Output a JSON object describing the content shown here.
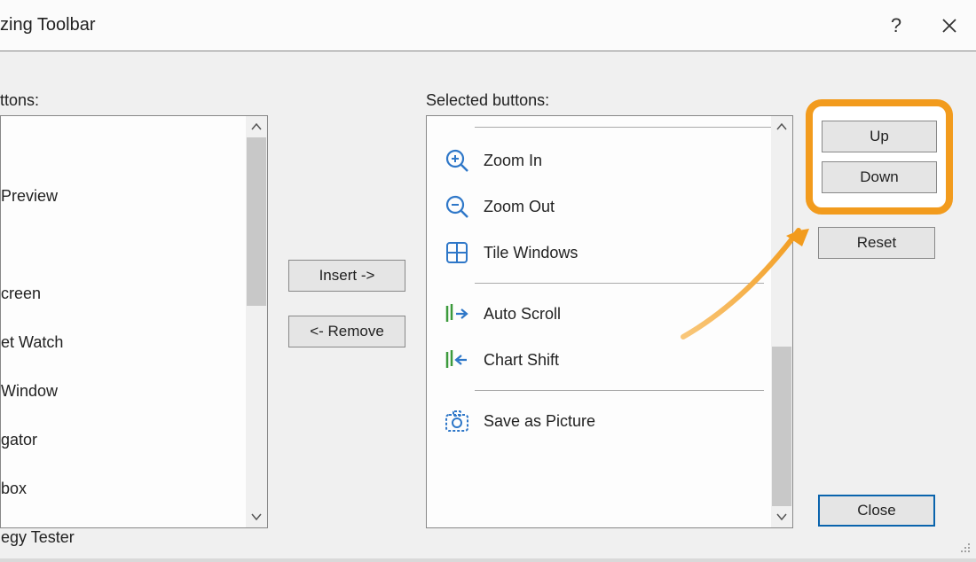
{
  "title": "zing Toolbar",
  "labels": {
    "available": "ttons:",
    "selected": "Selected buttons:"
  },
  "available_items": [
    "",
    "Preview",
    "",
    "creen",
    "et Watch",
    " Window",
    "gator",
    "box",
    "egy Tester"
  ],
  "selected_items": [
    {
      "icon": "zoom-in",
      "label": "Zoom In"
    },
    {
      "icon": "zoom-out",
      "label": "Zoom Out"
    },
    {
      "icon": "tile-windows",
      "label": "Tile Windows"
    },
    {
      "sep": true
    },
    {
      "icon": "auto-scroll",
      "label": "Auto Scroll"
    },
    {
      "icon": "chart-shift",
      "label": "Chart Shift"
    },
    {
      "sep": true
    },
    {
      "icon": "save-picture",
      "label": "Save as Picture"
    }
  ],
  "buttons": {
    "insert": "Insert ->",
    "remove": "<- Remove",
    "up": "Up",
    "down": "Down",
    "reset": "Reset",
    "close": "Close"
  }
}
